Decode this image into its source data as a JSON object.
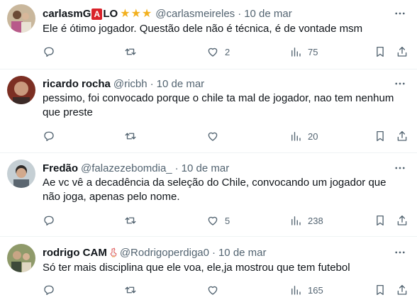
{
  "tweets": [
    {
      "name_pre": "carlasmG",
      "name_badge": "A",
      "name_post": "LO",
      "stars": "★★★",
      "handle": "@carlasmeireles",
      "dot": "·",
      "date": "10 de mar",
      "text": "Ele é ótimo jogador.  Questão dele não é técnica, é de vontade msm",
      "likes": "2",
      "views": "75",
      "avatar_color": "#b7a58a"
    },
    {
      "name": "ricardo rocha",
      "handle": "@ricbh",
      "dot": "·",
      "date": "10 de mar",
      "text": "pessimo, foi convocado porque o chile ta mal de jogador, nao tem nenhum que preste",
      "views": "20",
      "avatar_color": "#8a3a2c"
    },
    {
      "name": "Fredão",
      "handle": "@falazezebomdia_",
      "dot": "·",
      "date": "10 de mar",
      "text": "Ae vc vê a decadência da seleção do Chile, convocando um jogador que não joga, apenas pelo nome.",
      "likes": "5",
      "views": "238",
      "avatar_color": "#9aa8b0"
    },
    {
      "name": "rodrigo CAM",
      "handle": "@Rodrigoperdiga0",
      "dot": "·",
      "date": "10 de mar",
      "text": "Só ter mais disciplina que ele voa, ele,ja mostrou que tem futebol",
      "views": "165",
      "avatar_color": "#7d8a5c"
    }
  ],
  "icons": {
    "reply": "reply-icon",
    "retweet": "retweet-icon",
    "like": "heart-icon",
    "views": "views-icon",
    "bookmark": "bookmark-icon",
    "share": "share-icon",
    "more": "more-icon"
  }
}
